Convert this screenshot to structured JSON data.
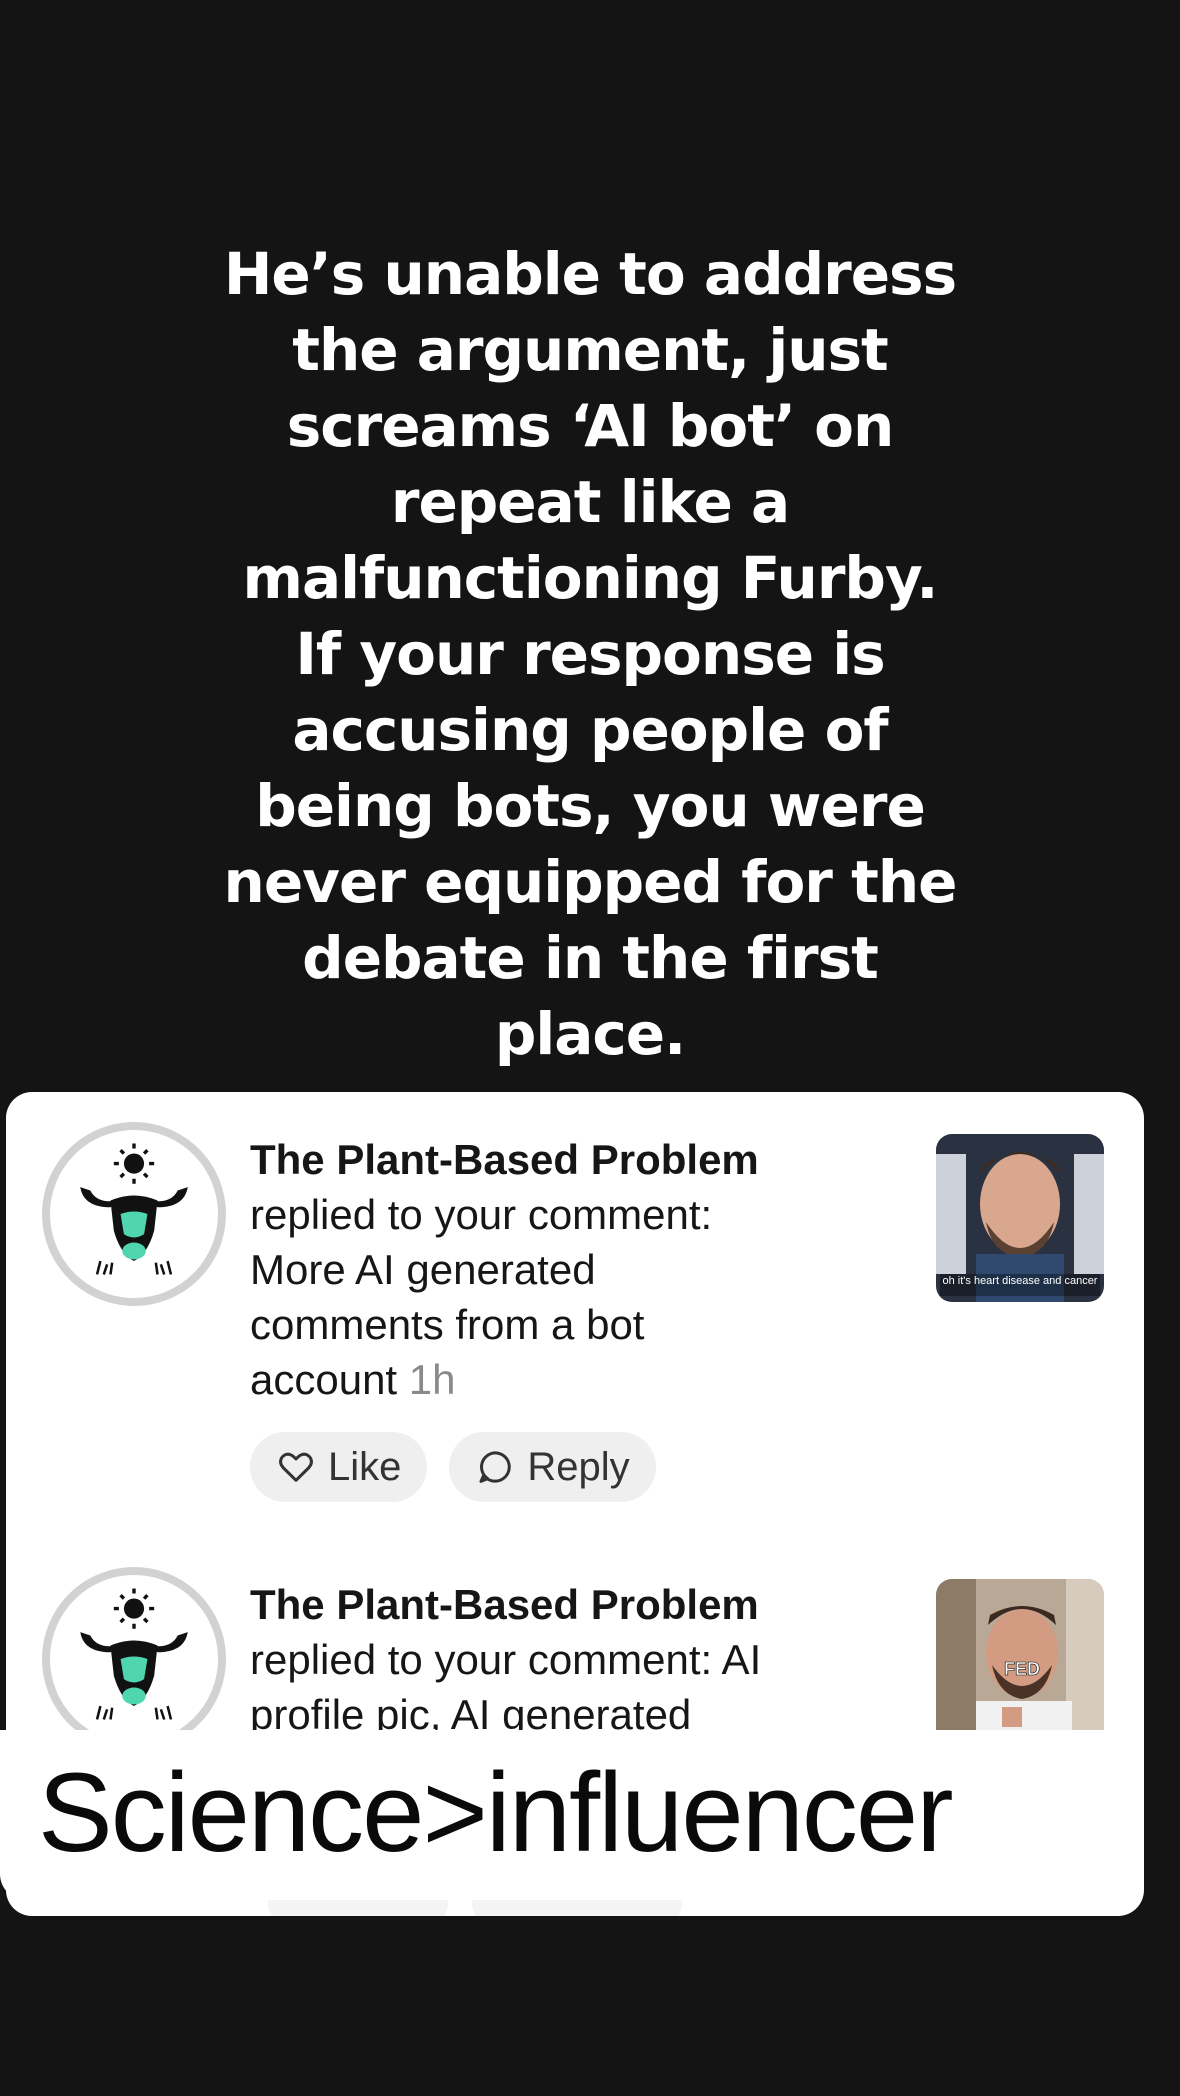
{
  "caption": {
    "lines": [
      "He’s unable to address",
      "the argument, just",
      "screams ‘AI bot’ on",
      "repeat like a",
      "malfunctioning Furby.",
      "If your response is",
      "accusing people of",
      "being bots, you were",
      "never equipped for the",
      "debate in the first",
      "place."
    ]
  },
  "notifications": [
    {
      "name": "The Plant-Based Problem",
      "lines": [
        "replied to your comment:",
        "More AI generated",
        "comments from a bot",
        "account"
      ],
      "time": "1h",
      "like_label": "Like",
      "reply_label": "Reply",
      "thumb_caption": "oh it's heart disease and cancer",
      "avatar_icon": "bull-logo-icon"
    },
    {
      "name": "The Plant-Based Problem",
      "lines": [
        "replied to your comment: AI",
        "profile pic, AI generated"
      ],
      "thumb_caption": "FED",
      "avatar_icon": "bull-logo-icon"
    }
  ],
  "banner": {
    "text": "Science>influencer"
  },
  "colors": {
    "background": "#141414",
    "card": "#ffffff",
    "pill": "#efefef",
    "muted_time": "#8a8a8a",
    "logo_teal": "#4fd6b0"
  }
}
